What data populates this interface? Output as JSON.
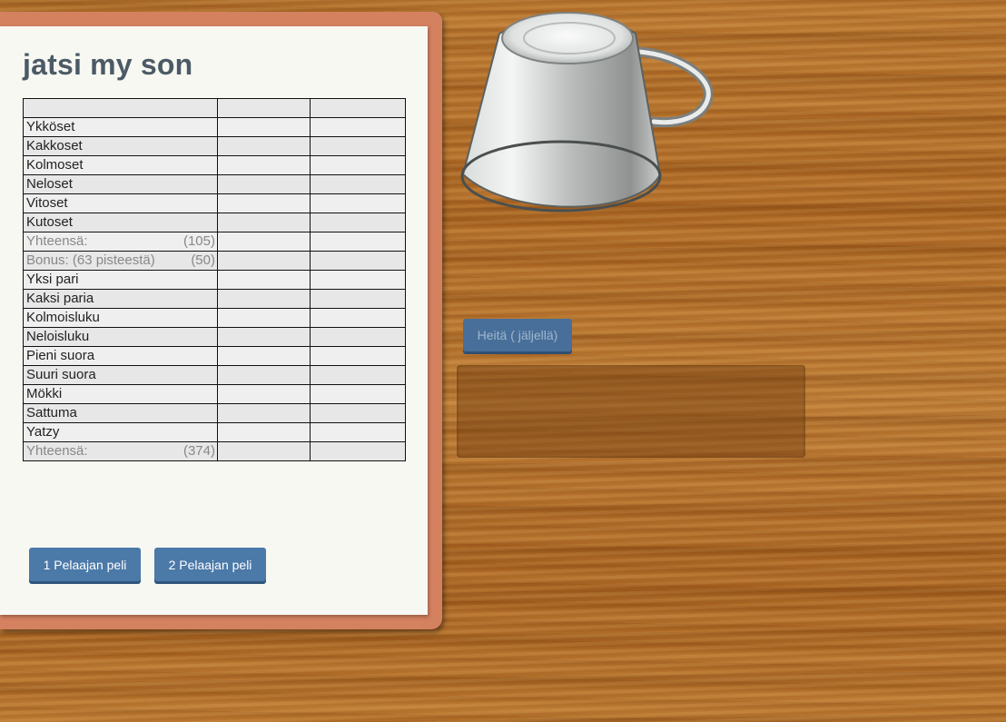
{
  "title": "jatsi my son",
  "score_rows": [
    {
      "label": "Ykköset",
      "hint": "",
      "kind": "cat"
    },
    {
      "label": "Kakkoset",
      "hint": "",
      "kind": "cat"
    },
    {
      "label": "Kolmoset",
      "hint": "",
      "kind": "cat"
    },
    {
      "label": "Neloset",
      "hint": "",
      "kind": "cat"
    },
    {
      "label": "Vitoset",
      "hint": "",
      "kind": "cat"
    },
    {
      "label": "Kutoset",
      "hint": "",
      "kind": "cat"
    },
    {
      "label": "Yhteensä:",
      "hint": "(105)",
      "kind": "sum"
    },
    {
      "label": "Bonus: (63 pisteestä)",
      "hint": "(50)",
      "kind": "sum"
    },
    {
      "label": "Yksi pari",
      "hint": "",
      "kind": "cat"
    },
    {
      "label": "Kaksi paria",
      "hint": "",
      "kind": "cat"
    },
    {
      "label": "Kolmoisluku",
      "hint": "",
      "kind": "cat"
    },
    {
      "label": "Neloisluku",
      "hint": "",
      "kind": "cat"
    },
    {
      "label": "Pieni suora",
      "hint": "",
      "kind": "cat"
    },
    {
      "label": "Suuri suora",
      "hint": "",
      "kind": "cat"
    },
    {
      "label": "Mökki",
      "hint": "",
      "kind": "cat"
    },
    {
      "label": "Sattuma",
      "hint": "",
      "kind": "cat"
    },
    {
      "label": "Yatzy",
      "hint": "",
      "kind": "cat"
    },
    {
      "label": "Yhteensä:",
      "hint": "(374)",
      "kind": "sum"
    }
  ],
  "buttons": {
    "one_player": "1 Pelaajan peli",
    "two_player": "2 Pelaajan peli",
    "roll": "Heitä ( jäljellä)"
  },
  "icons": {
    "dice_cup": "cup-icon"
  },
  "colors": {
    "button": "#4b79a8",
    "title": "#4c5a66",
    "panel_frame": "#d48160"
  }
}
